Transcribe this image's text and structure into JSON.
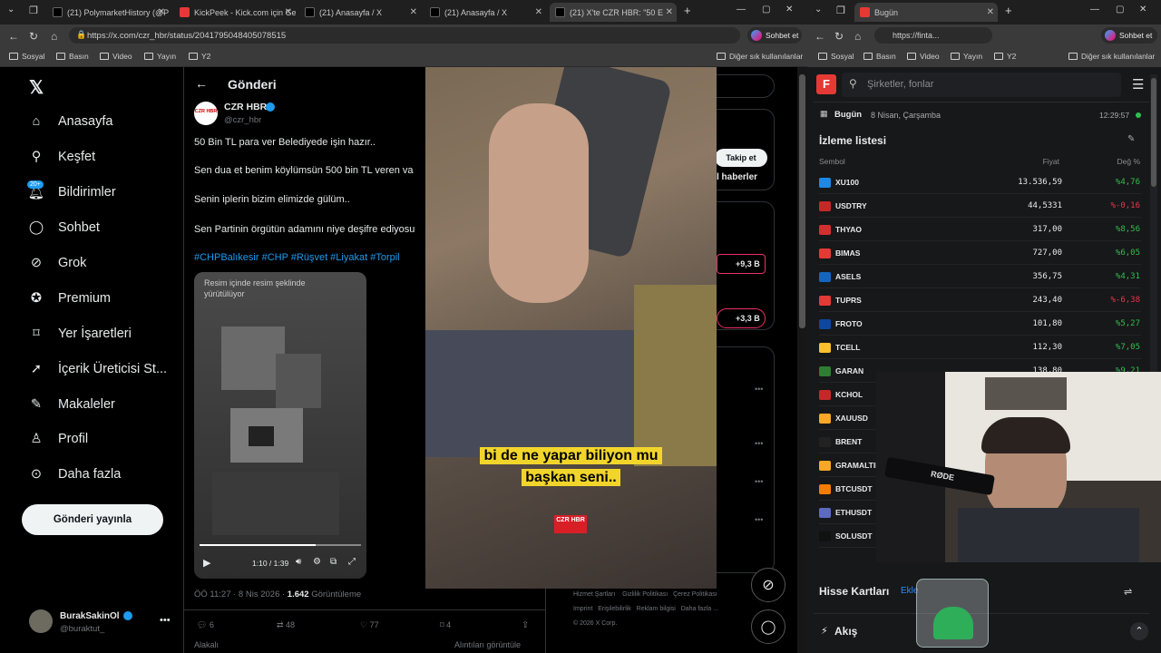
{
  "left_browser": {
    "tabs": [
      {
        "title": "(21) PolymarketHistory (@Po",
        "icon": "x-icon"
      },
      {
        "title": "KickPeek - Kick.com için Gen",
        "icon": "kick-icon"
      },
      {
        "title": "(21) Anasayfa / X",
        "icon": "x-icon"
      },
      {
        "title": "(21) Anasayfa / X",
        "icon": "x-icon"
      },
      {
        "title": "(21) X'te CZR HBR: \"50 E",
        "icon": "x-icon",
        "active": true
      }
    ],
    "url": "https://x.com/czr_hbr/status/2041795048405078515",
    "chat_button": "Sohbet et",
    "bookmarks": [
      "Sosyal",
      "Basın",
      "Video",
      "Yayın",
      "Y2"
    ],
    "other_bookmarks": "Diğer sık kullanılanlar"
  },
  "x_nav": {
    "items": [
      "Anasayfa",
      "Keşfet",
      "Bildirimler",
      "Sohbet",
      "Grok",
      "Premium",
      "Yer İşaretleri",
      "İçerik Üreticisi St...",
      "Makaleler",
      "Profil",
      "Daha fazla"
    ],
    "notif_badge": "20+",
    "post_button": "Gönderi yayınla",
    "user_name": "BurakSakinOl",
    "user_handle": "@buraktut_"
  },
  "post": {
    "header": "Gönderi",
    "author_name": "CZR HBR",
    "author_handle": "@czr_hbr",
    "avatar_text": "CZR HBR",
    "lines": [
      "50 Bin TL para ver Belediyede işin hazır..",
      "Sen dua et benim köylümsün 500 bin TL veren va",
      "Senin iplerin bizim elimizde gülüm..",
      "Sen Partinin örgütün adamını niye deşifre ediyosu"
    ],
    "hashtags": "#CHPBalıkesir #CHP #Rüşvet #Liyakat #Torpil",
    "pip_notice": "Resim içinde resim şeklinde yürütülüyor",
    "time_display": "1:10 / 1:39",
    "meta_time": "ÖÖ 11:27 · 8 Nis 2026 · ",
    "views_count": "1.642",
    "views_label": " Görüntüleme",
    "replies": "6",
    "reposts": "48",
    "likes": "77",
    "bookmarks": "4",
    "quotes_left": "Alakalı",
    "quotes_right": "Alıntıları görüntüle"
  },
  "right_column": {
    "follow_button": "Takip et",
    "news_text": "l haberler",
    "trend1": "+9,3 B",
    "trend2": "+3,3 B",
    "footer_lines": [
      "Hizmet Şartları",
      "Gizlilik Politikası",
      "Çerez Politikası",
      "Imprint",
      "Erişilebilirlik",
      "Reklam bilgisi",
      "Daha fazla ...",
      "© 2026 X Corp."
    ]
  },
  "video": {
    "subtitle_line1": "bi de ne yapar biliyon mu",
    "subtitle_line2": "başkan seni..",
    "logo": "CZR HBR"
  },
  "right_browser": {
    "tab_title": "Bugün",
    "url": "https://finta...",
    "chat_button": "Sohbet et",
    "bookmarks": [
      "Sosyal",
      "Basın",
      "Video",
      "Yayın",
      "Y2"
    ],
    "other_bookmarks": "Diğer sık kullanılanlar"
  },
  "fintables": {
    "search_placeholder": "Şirketler, fonlar",
    "today_label": "Bugün",
    "date": "8 Nisan, Çarşamba",
    "clock": "12:29:57",
    "watchlist_title": "İzleme listesi",
    "col_symbol": "Sembol",
    "col_price": "Fiyat",
    "col_change": "Değ %",
    "rows": [
      {
        "symbol": "XU100",
        "price": "13.536,59",
        "change": "%4,76",
        "dir": "up",
        "color": "#1e88e5"
      },
      {
        "symbol": "USDTRY",
        "price": "44,5331",
        "change": "%-0,16",
        "dir": "dn",
        "color": "#c62828"
      },
      {
        "symbol": "THYAO",
        "price": "317,00",
        "change": "%8,56",
        "dir": "up",
        "color": "#d32f2f"
      },
      {
        "symbol": "BIMAS",
        "price": "727,00",
        "change": "%6,05",
        "dir": "up",
        "color": "#e53935"
      },
      {
        "symbol": "ASELS",
        "price": "356,75",
        "change": "%4,31",
        "dir": "up",
        "color": "#1565c0"
      },
      {
        "symbol": "TUPRS",
        "price": "243,40",
        "change": "%-6,38",
        "dir": "dn",
        "color": "#e53935"
      },
      {
        "symbol": "FROTO",
        "price": "101,80",
        "change": "%5,27",
        "dir": "up",
        "color": "#0d47a1"
      },
      {
        "symbol": "TCELL",
        "price": "112,30",
        "change": "%7,05",
        "dir": "up",
        "color": "#fbc02d"
      },
      {
        "symbol": "GARAN",
        "price": "138,80",
        "change": "%9,21",
        "dir": "up",
        "color": "#2e7d32"
      },
      {
        "symbol": "KCHOL",
        "price": "",
        "change": "",
        "dir": "up",
        "color": "#c62828"
      },
      {
        "symbol": "XAUUSD",
        "price": "",
        "change": "",
        "dir": "up",
        "color": "#f9a825"
      },
      {
        "symbol": "BRENT",
        "price": "",
        "change": "",
        "dir": "up",
        "color": "#222222"
      },
      {
        "symbol": "GRAMALTIN",
        "price": "",
        "change": "",
        "dir": "up",
        "color": "#f9a825"
      },
      {
        "symbol": "BTCUSDT",
        "price": "",
        "change": "",
        "dir": "up",
        "color": "#f57c00"
      },
      {
        "symbol": "ETHUSDT",
        "price": "",
        "change": "",
        "dir": "up",
        "color": "#5c6bc0"
      },
      {
        "symbol": "SOLUSDT",
        "price": "",
        "change": "",
        "dir": "up",
        "color": "#111111"
      }
    ],
    "cards_title": "Hisse Kartları",
    "cards_link": "Ekle",
    "flow_title": "Akış"
  },
  "webcam": {
    "mic_label": "RØDE"
  }
}
